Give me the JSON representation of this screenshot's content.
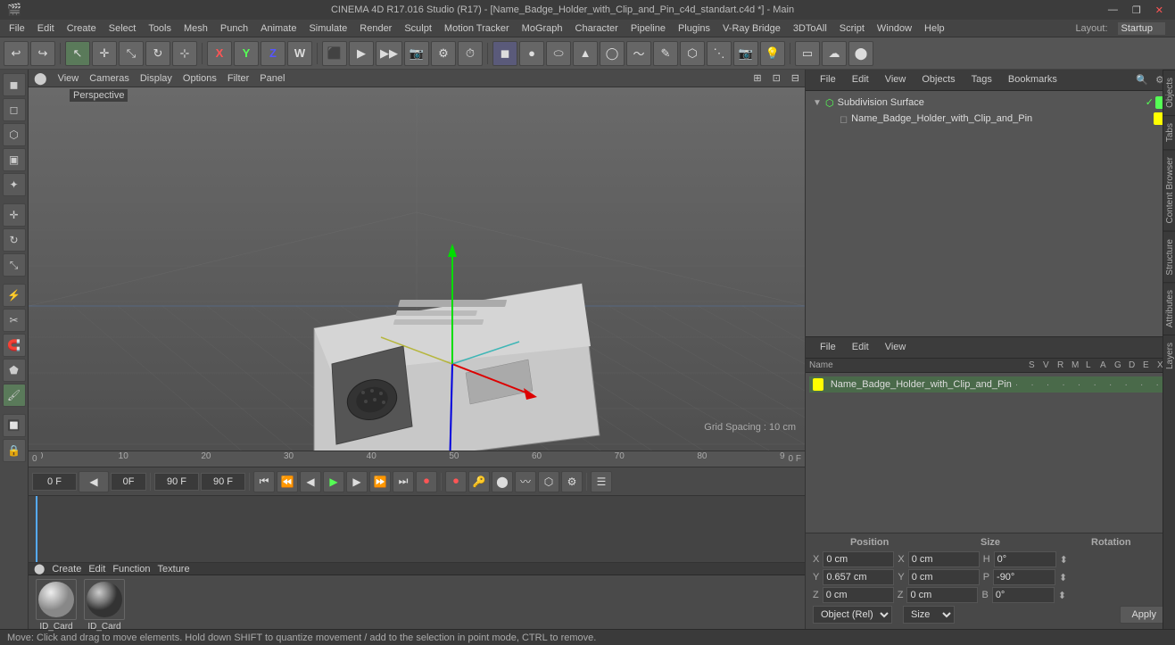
{
  "titlebar": {
    "title": "CINEMA 4D R17.016 Studio (R17) - [Name_Badge_Holder_with_Clip_and_Pin_c4d_standart.c4d *] - Main",
    "minimize": "—",
    "maximize": "❐",
    "close": "✕"
  },
  "menubar": {
    "items": [
      "File",
      "Edit",
      "Create",
      "Select",
      "Tools",
      "Mesh",
      "Punch",
      "Animate",
      "Simulate",
      "Render",
      "Sculpt",
      "Motion Tracker",
      "MoGraph",
      "Character",
      "Pipeline",
      "Plugins",
      "V-Ray Bridge",
      "3DToAll",
      "Script",
      "Window",
      "Help"
    ]
  },
  "toolbar": {
    "layout_label": "Layout:",
    "layout_value": "Startup"
  },
  "viewport": {
    "menu": [
      "View",
      "Cameras",
      "Display",
      "Options",
      "Filter",
      "Panel"
    ],
    "label": "Perspective",
    "grid_spacing": "Grid Spacing : 10 cm"
  },
  "objects_panel": {
    "tabs": [
      "File",
      "Edit",
      "View",
      "Objects",
      "Tags",
      "Bookmarks"
    ],
    "tree": [
      {
        "label": "Subdivision Surface",
        "color": "#5f5",
        "level": 0,
        "expanded": true
      },
      {
        "label": "Name_Badge_Holder_with_Clip_and_Pin",
        "color": "#ff0",
        "level": 1,
        "expanded": false
      }
    ]
  },
  "attributes_panel": {
    "tabs": [
      "File",
      "Edit",
      "View"
    ],
    "columns": [
      "Name",
      "S",
      "V",
      "R",
      "M",
      "L",
      "A",
      "G",
      "D",
      "E",
      "X"
    ],
    "items": [
      {
        "label": "Name_Badge_Holder_with_Clip_and_Pin",
        "color": "#ff0"
      }
    ]
  },
  "coords": {
    "position_label": "Position",
    "size_label": "Size",
    "rotation_label": "Rotation",
    "x_label": "X",
    "x_pos": "0 cm",
    "x_size": "0 cm",
    "y_label": "Y",
    "y_pos": "0.657 cm",
    "y_size": "0 cm",
    "z_label": "Z",
    "z_pos": "0 cm",
    "z_size": "0 cm",
    "h_label": "H",
    "h_rot": "0°",
    "p_label": "P",
    "p_rot": "-90°",
    "b_label": "B",
    "b_rot": "0°",
    "obj_rel_label": "Object (Rel)",
    "size_btn_label": "Size",
    "apply_label": "Apply"
  },
  "timeline": {
    "start_frame": "0 F",
    "current_frame": "0 F",
    "preview_start": "0F",
    "preview_end": "90 F",
    "end_frame": "90 F",
    "frame_markers": [
      0,
      10,
      20,
      30,
      40,
      50,
      60,
      70,
      80,
      90
    ],
    "fps_label": "0 F"
  },
  "material_editor": {
    "menu": [
      "Create",
      "Edit",
      "Function",
      "Texture"
    ],
    "items": [
      {
        "label": "ID_Card",
        "type": "diffuse"
      },
      {
        "label": "ID_Card",
        "type": "bump"
      }
    ]
  },
  "statusbar": {
    "text": "Move: Click and drag to move elements. Hold down SHIFT to quantize movement / add to the selection in point mode, CTRL to remove."
  },
  "side_tabs": [
    "Objects",
    "Tabs",
    "Content Browser",
    "Structure",
    "Attributes",
    "Layers"
  ],
  "icons": {
    "undo": "↩",
    "redo": "↪",
    "select": "↖",
    "move": "✛",
    "scale": "⤡",
    "rotate": "↻",
    "transform": "⊹",
    "axis_x": "X",
    "axis_y": "Y",
    "axis_z": "Z",
    "axis_w": "W",
    "render_view": "▶",
    "cube": "◼",
    "sphere": "●",
    "cylinder": "⬭",
    "cone": "▲",
    "torus": "◯",
    "camera": "📷",
    "light": "💡"
  }
}
